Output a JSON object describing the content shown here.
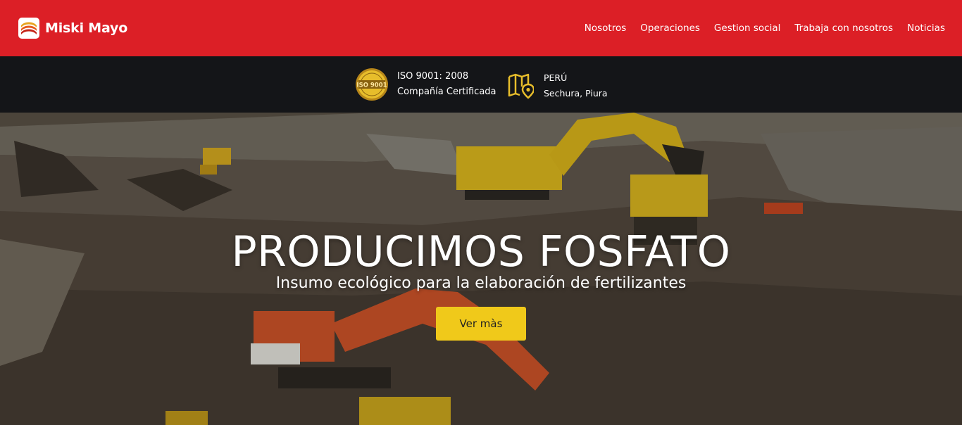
{
  "brand": {
    "name": "Miski Mayo"
  },
  "nav": {
    "items": [
      {
        "label": "Nosotros"
      },
      {
        "label": "Operaciones"
      },
      {
        "label": "Gestion social"
      },
      {
        "label": "Trabaja con nosotros"
      },
      {
        "label": "Noticias"
      }
    ]
  },
  "infobar": {
    "certification": {
      "badge_text": "ISO 9001",
      "title": "ISO 9001: 2008",
      "subtitle": "Compañía Certificada"
    },
    "location": {
      "country": "PERÚ",
      "place": "Sechura, Piura"
    }
  },
  "hero": {
    "title": "PRODUCIMOS FOSFATO",
    "subtitle": "Insumo ecológico para la elaboración de fertilizantes",
    "button_label": "Ver màs"
  },
  "colors": {
    "primary_red": "#dc1f26",
    "dark_bar": "#141518",
    "accent_yellow": "#f0c91a",
    "icon_gold": "#e7bd2b"
  },
  "icons": {
    "brand": "miski-mayo-logo-icon",
    "certification": "iso-9001-seal-icon",
    "location": "map-pin-icon"
  }
}
